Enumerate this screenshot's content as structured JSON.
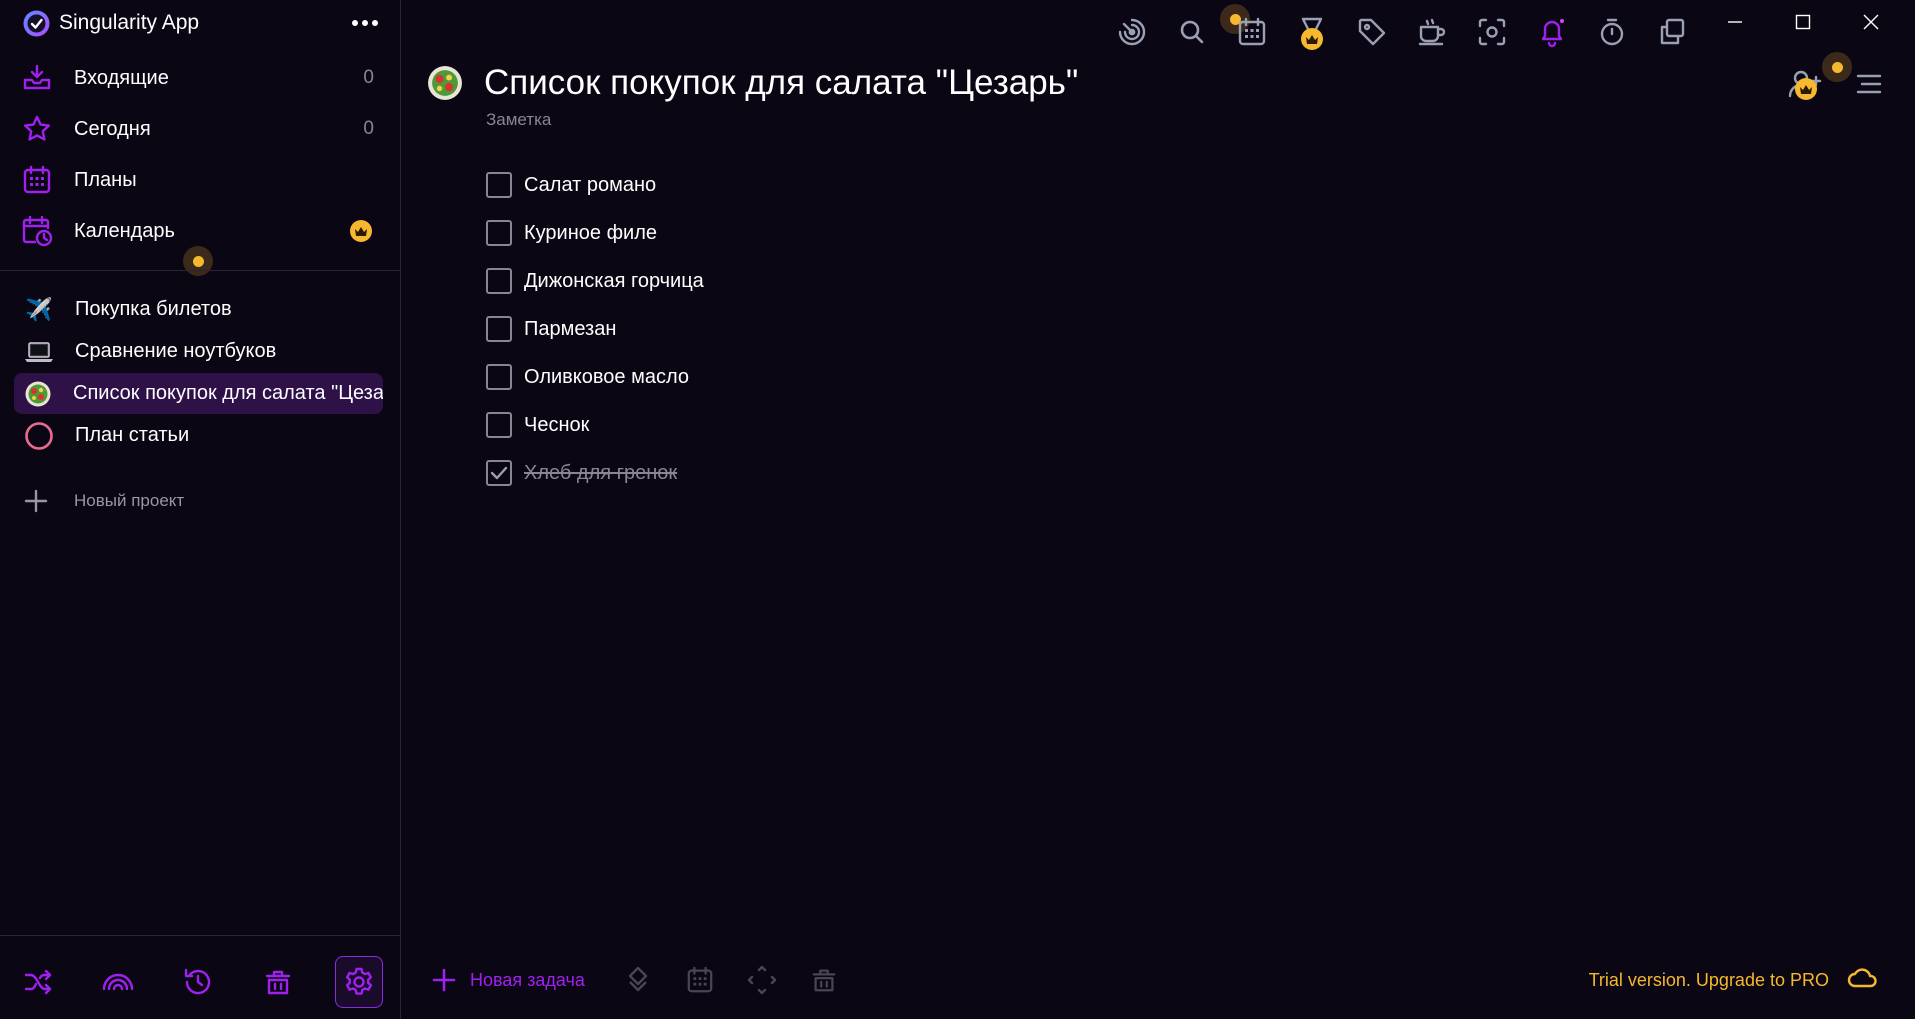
{
  "app": {
    "title": "Singularity App"
  },
  "sidebar": {
    "nav": [
      {
        "label": "Входящие",
        "count": "0",
        "icon": "inbox-icon"
      },
      {
        "label": "Сегодня",
        "count": "0",
        "icon": "star-icon"
      },
      {
        "label": "Планы",
        "icon": "calendar-grid-icon"
      },
      {
        "label": "Календарь",
        "icon": "calendar-clock-icon",
        "badge": "crown-icon"
      }
    ],
    "projects": [
      {
        "label": "Покупка билетов",
        "emoji": "✈️"
      },
      {
        "label": "Сравнение ноутбуков",
        "emoji": "💻"
      },
      {
        "label": "Список покупок для салата \"Цезарь\"",
        "emoji": "salad",
        "active": true
      },
      {
        "label": "План статьи",
        "icon": "circle-icon"
      }
    ],
    "new_project_label": "Новый проект",
    "bottom_buttons": [
      "shuffle-icon",
      "rainbow-icon",
      "history-icon",
      "trash-icon",
      "settings-icon"
    ]
  },
  "toolbar": {
    "icons": [
      "focus-icon",
      "search-icon",
      "calendar-icon",
      "medal-icon",
      "tag-icon",
      "coffee-icon",
      "screenshot-icon",
      "bell-icon",
      "timer-icon",
      "copy-icon"
    ]
  },
  "main": {
    "title": "Список покупок для салата \"Цезарь\"",
    "subtitle": "Заметка",
    "tasks": [
      {
        "label": "Салат романо",
        "done": false
      },
      {
        "label": "Куриное филе",
        "done": false
      },
      {
        "label": "Дижонская горчица",
        "done": false
      },
      {
        "label": "Пармезан",
        "done": false
      },
      {
        "label": "Оливковое масло",
        "done": false
      },
      {
        "label": "Чеснок",
        "done": false
      },
      {
        "label": "Хлеб для гренок",
        "done": true
      }
    ]
  },
  "bottom_bar": {
    "new_task_label": "Новая задача",
    "trial_text": "Trial version. Upgrade to PRO"
  },
  "colors": {
    "accent": "#a020f0",
    "gold": "#f5b82e",
    "background": "#0b0613",
    "active_item": "#2d1147"
  }
}
